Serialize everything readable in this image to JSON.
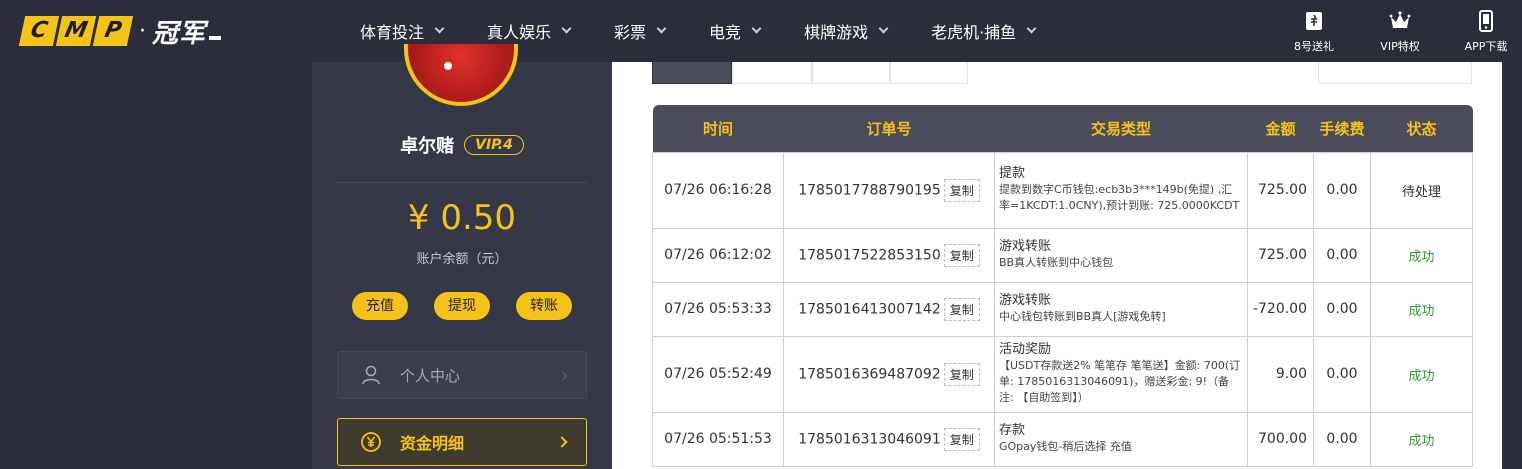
{
  "header": {
    "logo_letters": [
      "C",
      "M",
      "P"
    ],
    "logo_dot": "·",
    "logo_cn": "冠军",
    "nav": [
      {
        "label": "体育投注"
      },
      {
        "label": "真人娱乐"
      },
      {
        "label": "彩票"
      },
      {
        "label": "电竞"
      },
      {
        "label": "棋牌游戏"
      },
      {
        "label": "老虎机·捕鱼"
      }
    ],
    "right_links": [
      {
        "label": "8号送礼",
        "icon": "ticket-icon"
      },
      {
        "label": "VIP特权",
        "icon": "crown-icon"
      },
      {
        "label": "APP下载",
        "icon": "phone-icon"
      }
    ]
  },
  "sidebar": {
    "username": "卓尔赌",
    "vip": "VIP.4",
    "balance": "¥ 0.50",
    "balance_label": "账户余额（元）",
    "actions": [
      "充值",
      "提现",
      "转账"
    ],
    "menu": [
      {
        "label": "个人中心",
        "icon": "user-icon"
      },
      {
        "label": "资金明细",
        "icon": "yen-coin-icon"
      }
    ]
  },
  "table": {
    "headers": [
      "时间",
      "订单号",
      "交易类型",
      "金额",
      "手续费",
      "状态"
    ],
    "copy_label": "复制",
    "rows": [
      {
        "time": "07/26 06:16:28",
        "order": "1785017788790195",
        "type_title": "提款",
        "type_detail": "提款到数字C币钱包:ecb3b3***149b(免提) ,汇率=1KCDT:1.0CNY),预计到账: 725.0000KCDT",
        "amount": "725.00",
        "fee": "0.00",
        "status": "待处理",
        "status_type": "pending"
      },
      {
        "time": "07/26 06:12:02",
        "order": "1785017522853150",
        "type_title": "游戏转账",
        "type_detail": "BB真人转账到中心钱包",
        "amount": "725.00",
        "fee": "0.00",
        "status": "成功",
        "status_type": "success"
      },
      {
        "time": "07/26 05:53:33",
        "order": "1785016413007142",
        "type_title": "游戏转账",
        "type_detail": "中心钱包转账到BB真人[游戏免转]",
        "amount": "-720.00",
        "fee": "0.00",
        "status": "成功",
        "status_type": "success"
      },
      {
        "time": "07/26 05:52:49",
        "order": "1785016369487092",
        "type_title": "活动奖励",
        "type_detail": "【USDT存款送2% 笔笔存 笔笔送】金额: 700(订单: 1785016313046091)，赠送彩金: 9!（备注: 【自助签到】）",
        "amount": "9.00",
        "fee": "0.00",
        "status": "成功",
        "status_type": "success"
      },
      {
        "time": "07/26 05:51:53",
        "order": "1785016313046091",
        "type_title": "存款",
        "type_detail": "GOpay钱包-稍后选择 充值",
        "amount": "700.00",
        "fee": "0.00",
        "status": "成功",
        "status_type": "success"
      }
    ]
  }
}
